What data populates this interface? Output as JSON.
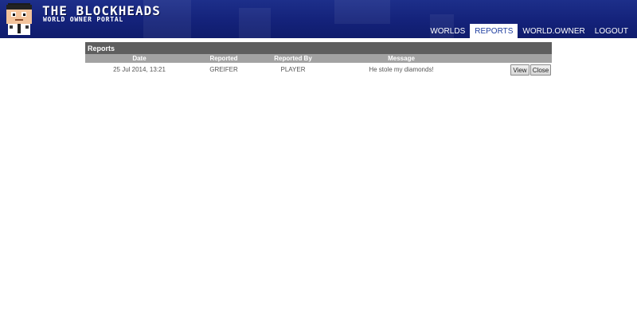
{
  "brand": {
    "title": "THE BLOCKHEADS",
    "subtitle": "WORLD OWNER PORTAL"
  },
  "nav": {
    "items": [
      {
        "label": "WORLDS",
        "active": false
      },
      {
        "label": "REPORTS",
        "active": true
      },
      {
        "label": "WORLD.OWNER",
        "active": false
      },
      {
        "label": "LOGOUT",
        "active": false
      }
    ]
  },
  "reports": {
    "title": "Reports",
    "columns": [
      "Date",
      "Reported",
      "Reported By",
      "Message"
    ],
    "rows": [
      {
        "date": "25 Jul 2014, 13:21",
        "reported": "GREIFER",
        "reported_by": "PLAYER",
        "message": "He stole my diamonds!",
        "view_label": "View",
        "close_label": "Close"
      }
    ]
  },
  "colors": {
    "header_bg": "#14227a",
    "active_tab_text": "#1f3fa0",
    "panel_title_bg": "#5e5e5e",
    "column_header_bg": "#a2a2a2"
  }
}
